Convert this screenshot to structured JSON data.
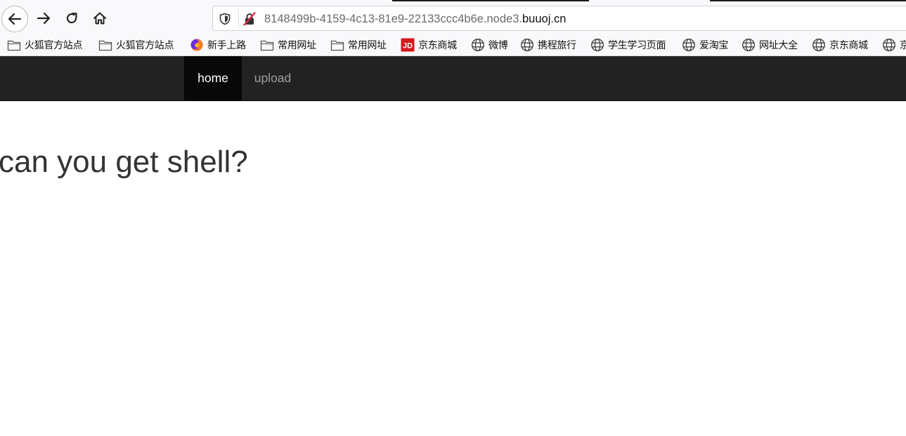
{
  "browser": {
    "url_dim": "8148499b-4159-4c13-81e9-22133ccc4b6e.node3.",
    "url_main": "buuoj.cn"
  },
  "bookmarks": [
    {
      "label": "火狐官方站点",
      "icon": "folder-icon"
    },
    {
      "label": "火狐官方站点",
      "icon": "folder-icon"
    },
    {
      "label": "新手上路",
      "icon": "firefox-icon"
    },
    {
      "label": "常用网址",
      "icon": "folder-icon"
    },
    {
      "label": "常用网址",
      "icon": "folder-icon"
    },
    {
      "label": "京东商城",
      "icon": "jd-icon"
    },
    {
      "label": "微博",
      "icon": "globe-icon"
    },
    {
      "label": "携程旅行",
      "icon": "globe-icon"
    },
    {
      "label": "学生学习页面",
      "icon": "globe-icon"
    },
    {
      "label": "爱淘宝",
      "icon": "globe-icon"
    },
    {
      "label": "网址大全",
      "icon": "globe-icon"
    },
    {
      "label": "京东商城",
      "icon": "globe-icon"
    },
    {
      "label": "京",
      "icon": "globe-icon"
    }
  ],
  "navbar": {
    "items": [
      {
        "label": "home",
        "active": true
      },
      {
        "label": "upload",
        "active": false
      }
    ]
  },
  "main": {
    "headline": "can you get shell?"
  },
  "colors": {
    "navbar_bg": "#222222",
    "navbar_active_bg": "#080808",
    "nav_inactive_text": "#9d9d9d",
    "jd_red": "#d71920"
  }
}
